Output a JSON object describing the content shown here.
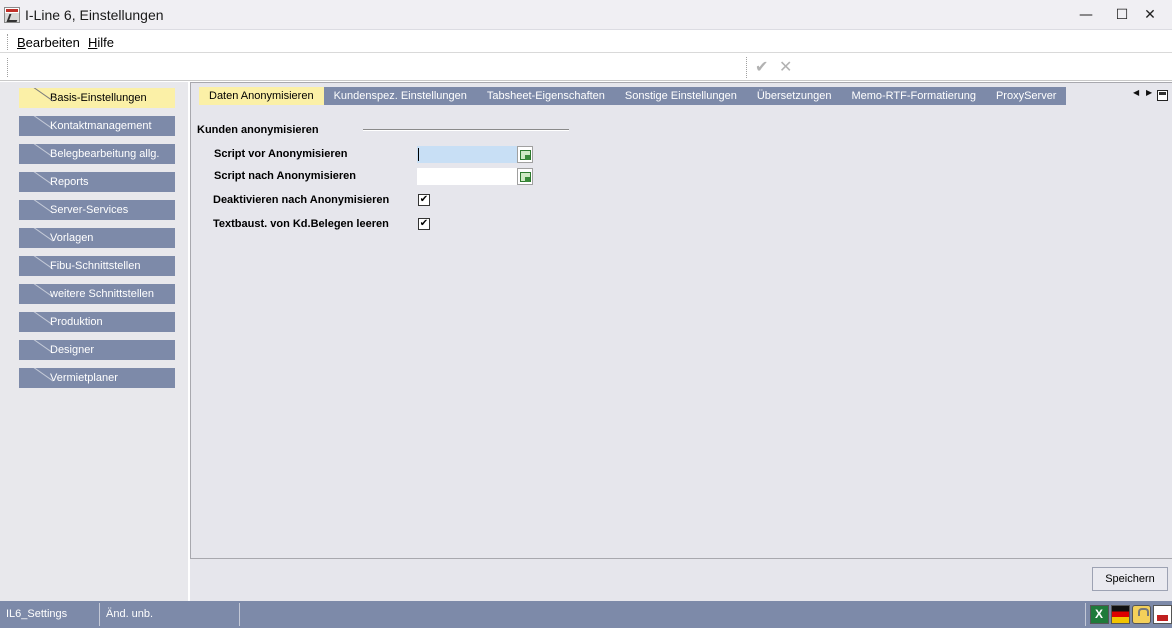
{
  "window": {
    "title": "I-Line 6, Einstellungen",
    "minimize_glyph": "—",
    "maximize_glyph": "☐",
    "close_glyph": "✕"
  },
  "menu": {
    "items": [
      {
        "mnemonic": "B",
        "rest": "earbeiten"
      },
      {
        "mnemonic": "H",
        "rest": "ilfe"
      }
    ]
  },
  "toolbar": {
    "confirm_glyph": "✔",
    "cancel_glyph": "✕",
    "icons": [
      "check-icon",
      "cancel-icon"
    ]
  },
  "sidebar": {
    "items": [
      {
        "label": "Basis-Einstellungen",
        "active": true
      },
      {
        "label": "Kontaktmanagement"
      },
      {
        "label": "Belegbearbeitung allg."
      },
      {
        "label": "Reports"
      },
      {
        "label": "Server-Services"
      },
      {
        "label": "Vorlagen"
      },
      {
        "label": "Fibu-Schnittstellen"
      },
      {
        "label": "weitere Schnittstellen"
      },
      {
        "label": "Produktion"
      },
      {
        "label": "Designer"
      },
      {
        "label": "Vermietplaner"
      }
    ]
  },
  "tabs": {
    "items": [
      {
        "label": "Daten Anonymisieren",
        "active": true
      },
      {
        "label": "Kundenspez. Einstellungen"
      },
      {
        "label": "Tabsheet-Eigenschaften"
      },
      {
        "label": "Sonstige Einstellungen"
      },
      {
        "label": "Übersetzungen"
      },
      {
        "label": "Memo-RTF-Formatierung"
      },
      {
        "label": "ProxyServer"
      }
    ],
    "prev_glyph": "◀",
    "next_glyph": "▶"
  },
  "form": {
    "group_title": "Kunden anonymisieren",
    "script_before_label": "Script vor Anonymisieren",
    "script_before_value": "",
    "script_after_label": "Script nach Anonymisieren",
    "script_after_value": "",
    "deactivate_label": "Deaktivieren nach Anonymisieren",
    "deactivate_checked": true,
    "clear_texts_label": "Textbaust. von Kd.Belegen leeren",
    "clear_texts_checked": true,
    "check_glyph": "✔"
  },
  "footer": {
    "save_label": "Speichern"
  },
  "statusbar": {
    "settings_name": "IL6_Settings",
    "change_status": "Änd. unb.",
    "icons": [
      "excel-icon",
      "german-flag-icon",
      "lock-icon",
      "printer-icon"
    ]
  },
  "colors": {
    "nav_background": "#7d8aa9",
    "active_highlight": "#fbf0a7",
    "panel_background": "#e6e6ec",
    "focused_input": "#c8dff5"
  }
}
